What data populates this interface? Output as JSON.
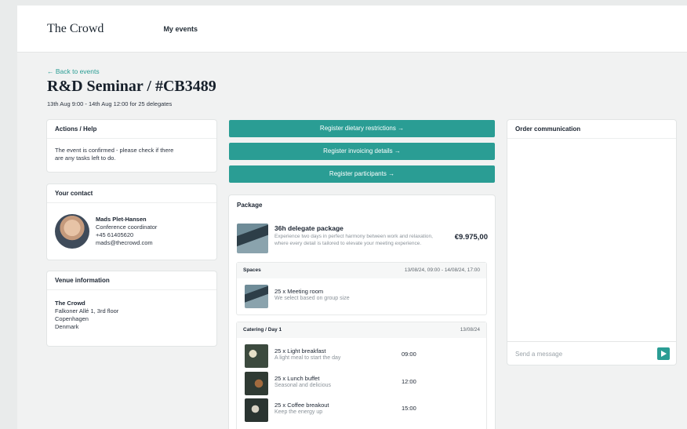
{
  "header": {
    "logo": "The Crowd",
    "nav_my_events": "My events"
  },
  "event": {
    "back_link": "← Back to events",
    "title": "R&D Seminar / #CB3489",
    "subtitle": "13th Aug 9:00 - 14th Aug 12:00 for 25 delegates"
  },
  "actions": {
    "heading": "Actions / Help",
    "text": "The event is confirmed - please check if there are any tasks left to do."
  },
  "contact": {
    "heading": "Your contact",
    "name": "Mads Plet-Hansen",
    "role": "Conference coordinator",
    "phone": "+45 61405620",
    "email": "mads@thecrowd.com"
  },
  "venue": {
    "heading": "Venue information",
    "name": "The Crowd",
    "address1": "Falkoner Allé 1, 3rd floor",
    "city": "Copenhagen",
    "country": "Denmark"
  },
  "buttons": {
    "dietary": "Register dietary restrictions →",
    "invoicing": "Register invoicing details →",
    "participants": "Register participants →"
  },
  "package": {
    "heading": "Package",
    "name": "36h delegate package",
    "description": "Experience two days in perfect harmony between work and relaxation, where every detail is tailored to elevate your meeting experience.",
    "price": "€9.975,00",
    "spaces": {
      "heading": "Spaces",
      "date": "13/08/24, 09:00 - 14/08/24, 17:00",
      "items": [
        {
          "title": "25 x Meeting room",
          "subtitle": "We select based on group size"
        }
      ]
    },
    "catering": {
      "heading": "Catering / Day 1",
      "date": "13/08/24",
      "items": [
        {
          "title": "25 x Light breakfast",
          "subtitle": "A light meal to start the day",
          "time": "09:00"
        },
        {
          "title": "25 x Lunch buffet",
          "subtitle": "Seasonal and delicious",
          "time": "12:00"
        },
        {
          "title": "25 x Coffee breakout",
          "subtitle": "Keep the energy up",
          "time": "15:00"
        }
      ]
    }
  },
  "communication": {
    "heading": "Order communication",
    "input_placeholder": "Send a message"
  },
  "icons": {
    "send": "send-arrow-icon"
  },
  "colors": {
    "accent": "#2a9d94",
    "background": "#f1f2f2"
  }
}
